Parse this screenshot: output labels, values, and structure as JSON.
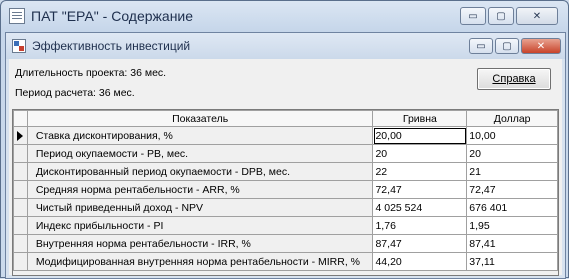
{
  "outer_window": {
    "title": "ПАТ \"ЕРА\" - Содержание",
    "controls": {
      "minimize": "▭",
      "maximize": "▢",
      "close": "✕"
    }
  },
  "inner_window": {
    "title": "Эффективность инвестиций",
    "controls": {
      "minimize": "▭",
      "maximize": "▢",
      "close": "✕"
    }
  },
  "info": {
    "duration": "Длительность проекта: 36 мес.",
    "period": "Период расчета: 36 мес."
  },
  "help_button": "Справка",
  "table": {
    "headers": {
      "indicator": "Показатель",
      "hryvnia": "Гривна",
      "dollar": "Доллар"
    },
    "rows": [
      {
        "name": "Ставка дисконтирования, %",
        "uah": "20,00",
        "usd": "10,00"
      },
      {
        "name": "Период окупаемости - PB, мес.",
        "uah": "20",
        "usd": "20"
      },
      {
        "name": "Дисконтированный период окупаемости - DPB, мес.",
        "uah": "22",
        "usd": "21"
      },
      {
        "name": "Средняя норма рентабельности - ARR, %",
        "uah": "72,47",
        "usd": "72,47"
      },
      {
        "name": "Чистый приведенный доход - NPV",
        "uah": "4 025 524",
        "usd": "676 401"
      },
      {
        "name": "Индекс прибыльности - PI",
        "uah": "1,76",
        "usd": "1,95"
      },
      {
        "name": "Внутренняя норма рентабельности - IRR, %",
        "uah": "87,47",
        "usd": "87,41"
      },
      {
        "name": "Модифицированная внутренняя норма рентабельности - MIRR, %",
        "uah": "44,20",
        "usd": "37,11"
      }
    ]
  }
}
